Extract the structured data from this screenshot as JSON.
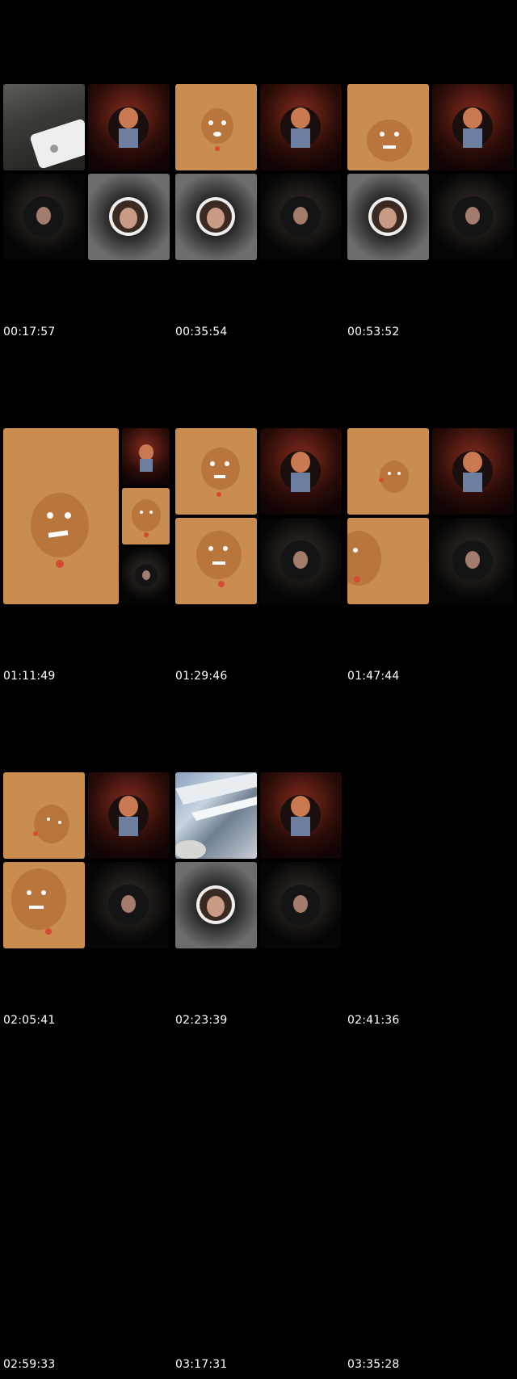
{
  "timestamps": [
    "00:17:57",
    "00:35:54",
    "00:53:52",
    "01:11:49",
    "01:29:46",
    "01:47:44",
    "02:05:41",
    "02:23:39",
    "02:41:36",
    "02:59:33",
    "03:17:31",
    "03:35:28"
  ],
  "colors": {
    "background": "#000000",
    "gingerbread": "#c98e4f",
    "text": "#ffffff"
  },
  "icons": [
    "gingerbread-face-icon",
    "avatar-icon",
    "circle-avatar-icon",
    "phone-icon",
    "window-icon"
  ]
}
